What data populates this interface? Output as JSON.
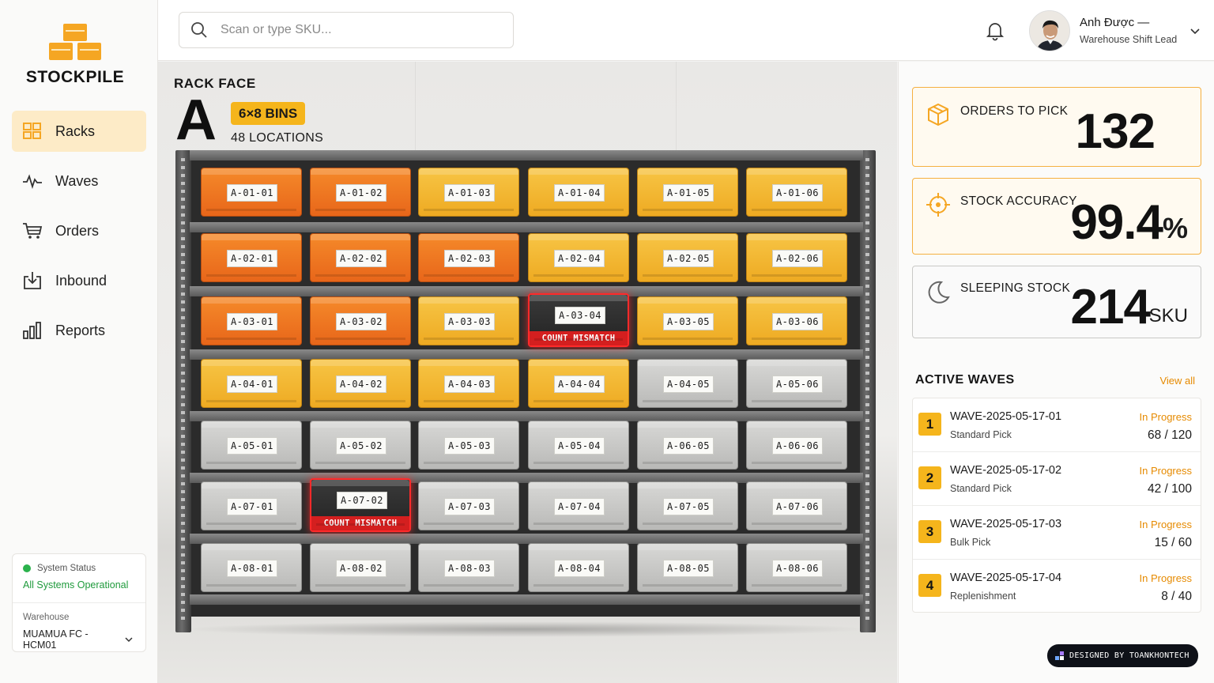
{
  "brand": {
    "name": "STOCKPILE"
  },
  "nav": {
    "items": [
      {
        "label": "Racks",
        "icon": "grid-icon",
        "active": true
      },
      {
        "label": "Waves",
        "icon": "activity-icon",
        "active": false
      },
      {
        "label": "Orders",
        "icon": "cart-icon",
        "active": false
      },
      {
        "label": "Inbound",
        "icon": "inbound-icon",
        "active": false
      },
      {
        "label": "Reports",
        "icon": "bar-chart-icon",
        "active": false
      }
    ]
  },
  "system_status": {
    "label": "System Status",
    "value": "All Systems Operational",
    "color": "#2bb24c"
  },
  "warehouse": {
    "label": "Warehouse",
    "value": "MUAMUA FC - HCM01"
  },
  "search": {
    "placeholder": "Scan or type SKU..."
  },
  "user": {
    "name": "Anh Được —",
    "role": "Warehouse Shift Lead"
  },
  "rack": {
    "title": "RACK FACE",
    "letter": "A",
    "bins_badge": "6×8 BINS",
    "locations": "48 LOCATIONS",
    "mismatch_label": "COUNT MISMATCH",
    "rows": [
      [
        {
          "code": "A-01-01",
          "color": "orange"
        },
        {
          "code": "A-01-02",
          "color": "orange"
        },
        {
          "code": "A-01-03",
          "color": "yellow"
        },
        {
          "code": "A-01-04",
          "color": "yellow"
        },
        {
          "code": "A-01-05",
          "color": "yellow"
        },
        {
          "code": "A-01-06",
          "color": "yellow"
        }
      ],
      [
        {
          "code": "A-02-01",
          "color": "orange"
        },
        {
          "code": "A-02-02",
          "color": "orange"
        },
        {
          "code": "A-02-03",
          "color": "orange"
        },
        {
          "code": "A-02-04",
          "color": "yellow"
        },
        {
          "code": "A-02-05",
          "color": "yellow"
        },
        {
          "code": "A-02-06",
          "color": "yellow"
        }
      ],
      [
        {
          "code": "A-03-01",
          "color": "orange"
        },
        {
          "code": "A-03-02",
          "color": "orange"
        },
        {
          "code": "A-03-03",
          "color": "yellow"
        },
        {
          "code": "A-03-04",
          "color": "mismatch"
        },
        {
          "code": "A-03-05",
          "color": "yellow"
        },
        {
          "code": "A-03-06",
          "color": "yellow"
        }
      ],
      [
        {
          "code": "A-04-01",
          "color": "yellow"
        },
        {
          "code": "A-04-02",
          "color": "yellow"
        },
        {
          "code": "A-04-03",
          "color": "yellow"
        },
        {
          "code": "A-04-04",
          "color": "yellow"
        },
        {
          "code": "A-04-05",
          "color": "gray"
        },
        {
          "code": "A-05-06",
          "color": "gray"
        }
      ],
      [
        {
          "code": "A-05-01",
          "color": "gray"
        },
        {
          "code": "A-05-02",
          "color": "gray"
        },
        {
          "code": "A-05-03",
          "color": "gray"
        },
        {
          "code": "A-05-04",
          "color": "gray"
        },
        {
          "code": "A-06-05",
          "color": "gray"
        },
        {
          "code": "A-06-06",
          "color": "gray"
        }
      ],
      [
        {
          "code": "A-07-01",
          "color": "gray"
        },
        {
          "code": "A-07-02",
          "color": "mismatch"
        },
        {
          "code": "A-07-03",
          "color": "gray"
        },
        {
          "code": "A-07-04",
          "color": "gray"
        },
        {
          "code": "A-07-05",
          "color": "gray"
        },
        {
          "code": "A-07-06",
          "color": "gray"
        }
      ],
      [
        {
          "code": "A-08-01",
          "color": "gray"
        },
        {
          "code": "A-08-02",
          "color": "gray"
        },
        {
          "code": "A-08-03",
          "color": "gray"
        },
        {
          "code": "A-08-04",
          "color": "gray"
        },
        {
          "code": "A-08-05",
          "color": "gray"
        },
        {
          "code": "A-08-06",
          "color": "gray"
        }
      ]
    ]
  },
  "kpis": [
    {
      "label": "ORDERS TO PICK",
      "value": "132",
      "unit": "",
      "icon": "package-icon",
      "style": "orange"
    },
    {
      "label": "STOCK ACCURACY",
      "value": "99.4",
      "unit": "%",
      "icon": "target-icon",
      "style": "orange"
    },
    {
      "label": "SLEEPING STOCK",
      "value": "214",
      "unit": "SKU",
      "icon": "moon-icon",
      "style": "gray"
    }
  ],
  "waves": {
    "title": "ACTIVE WAVES",
    "view_all": "View all",
    "items": [
      {
        "num": "1",
        "id": "WAVE-2025-05-17-01",
        "type": "Standard Pick",
        "status": "In Progress",
        "progress": "68 / 120"
      },
      {
        "num": "2",
        "id": "WAVE-2025-05-17-02",
        "type": "Standard Pick",
        "status": "In Progress",
        "progress": "42 / 100"
      },
      {
        "num": "3",
        "id": "WAVE-2025-05-17-03",
        "type": "Bulk Pick",
        "status": "In Progress",
        "progress": "15 / 60"
      },
      {
        "num": "4",
        "id": "WAVE-2025-05-17-04",
        "type": "Replenishment",
        "status": "In Progress",
        "progress": "8 / 40"
      }
    ]
  },
  "credit": {
    "text": "DESIGNED BY TOANKHONTECH"
  },
  "colors": {
    "accent": "#f5b51c",
    "orange_bin": "#e8661a",
    "yellow_bin": "#eeaa22",
    "gray_bin": "#b9b9b7",
    "mismatch": "#ff2a2a",
    "link": "#e68a00"
  }
}
